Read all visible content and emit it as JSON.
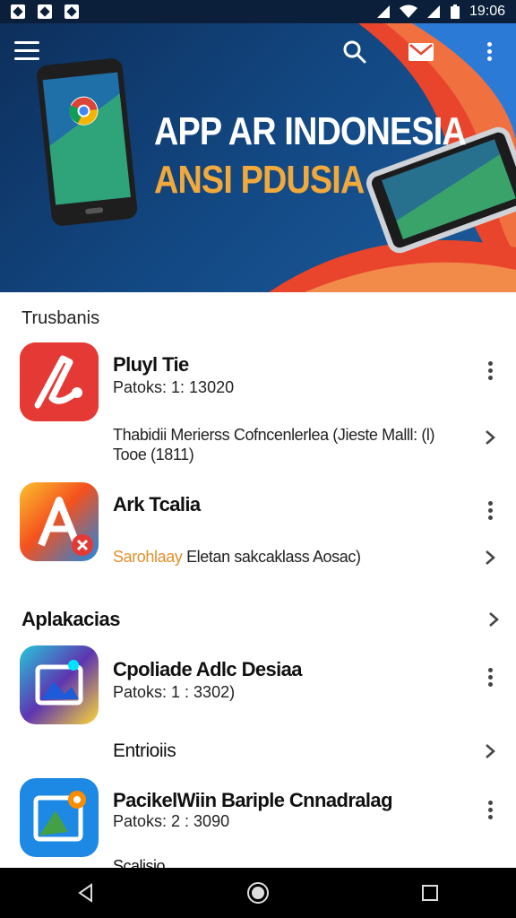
{
  "status_bar": {
    "time": "19:06"
  },
  "header": {
    "title": "APP AR INDONESIA",
    "subtitle": "ANSI PDUSIA"
  },
  "sections": {
    "first_label": "Trusbanis",
    "second_title": "Aplakacias"
  },
  "apps": [
    {
      "name": "Pluyl Tie",
      "meta": "Patoks: 1: 13020",
      "icon": "pen-icon",
      "color": "#e53935"
    },
    {
      "name": "Ark Tcalia",
      "meta": "",
      "icon": "letter-a-icon",
      "color": "#fb8c00"
    },
    {
      "name": "Cpoliade Adlc Desiaa",
      "meta": "Patoks: 1 : 3302)",
      "icon": "photo-mountain-icon",
      "color": "#3f51b5"
    },
    {
      "name": "PacikelWiin Bariple Cnnadralag",
      "meta": "Patoks: 2 : 3090",
      "icon": "map-pin-icon",
      "color": "#1e88e5"
    }
  ],
  "descriptions": {
    "app1_desc": "Thabidii Merierss Cofncenlerlea (Jieste Malll: (l) Tooe (1811)",
    "app2_accent": "Sarohlaay",
    "app2_desc": "Eletan sakcaklass Aosac)",
    "subsection": "Entrioiis",
    "partial_row": "Scalisio"
  }
}
